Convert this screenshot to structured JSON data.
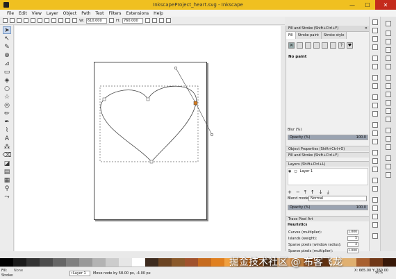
{
  "window": {
    "title": "InkscapeProject_heart.svg - Inkscape",
    "minimize": "—",
    "maximize": "☐",
    "close": "✕"
  },
  "menu": [
    "File",
    "Edit",
    "View",
    "Layer",
    "Object",
    "Path",
    "Text",
    "Filters",
    "Extensions",
    "Help"
  ],
  "toolbar": {
    "w_label": "W:",
    "w_value": "610.000",
    "h_label": "H:",
    "h_value": "760.000"
  },
  "dock": {
    "fill_stroke_title": "Fill and Stroke (Shift+Ctrl+F)",
    "tabs": [
      "Fill",
      "Stroke paint",
      "Stroke style"
    ],
    "no_paint": "No paint",
    "blur_label": "Blur (%)",
    "opacity_label": "Opacity (%)",
    "opacity_value": "100.0",
    "blur_value": "0.0",
    "opacity_fraction": 1.0,
    "object_properties": "Object Properties (Shift+Ctrl+O)",
    "fill_stroke_collapsed": "Fill and Stroke (Shift+Ctrl+F)",
    "layers_title": "Layers (Shift+Ctrl+L)",
    "layer_name": "Layer 1",
    "blend_label": "Blend mode:",
    "blend_value": "Normal",
    "layer_opacity_label": "Opacity (%)",
    "layer_opacity_value": "100.0",
    "trace_title": "Trace Pixel Art",
    "heuristics": "Heuristics",
    "params": [
      {
        "label": "Curves (multiplier):",
        "value": "1.000"
      },
      {
        "label": "Islands (weight):",
        "value": "5"
      },
      {
        "label": "Sparse pixels (window radius):",
        "value": "4"
      },
      {
        "label": "Sparse pixels (multiplier):",
        "value": "1.000"
      }
    ]
  },
  "status": {
    "fill_label": "Fill:",
    "stroke_label": "Stroke:",
    "fill_value": "None",
    "layer": "•Layer 1",
    "message": "Move node by 58.00 px, -4.00 px",
    "coords": "X: 665.00  Y: 760.00",
    "zoom": "90%"
  },
  "palette_colors": [
    "#000000",
    "#1a1a1a",
    "#333333",
    "#4d4d4d",
    "#666666",
    "#808080",
    "#999999",
    "#b3b3b3",
    "#cccccc",
    "#e6e6e6",
    "#ffffff",
    "#3d2b1f",
    "#6b4423",
    "#8b5a2b",
    "#a0522d",
    "#c66b1e",
    "#e08020",
    "#f0a040",
    "#b55d10",
    "#7a3e0e",
    "#4a2a10",
    "#d9a066",
    "#c08040",
    "#905020",
    "#603010",
    "#f2c080",
    "#e0b070",
    "#a86030",
    "#703818",
    "#381808"
  ],
  "watermark": "掘金技术社区 @ 布客飞龙"
}
